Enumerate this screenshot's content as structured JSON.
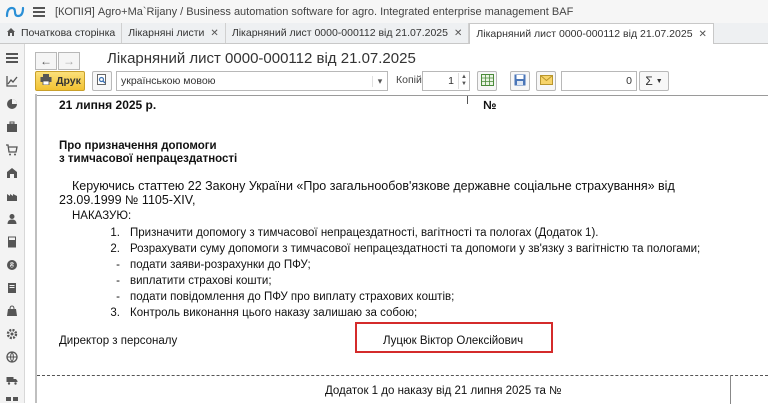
{
  "app": {
    "title": "[КОПІЯ] Agro+Ma`Rijany / Business automation software for agro. Integrated enterprise management BAF"
  },
  "tabs": [
    {
      "label": "Початкова сторінка",
      "closable": false
    },
    {
      "label": "Лікарняні листи",
      "closable": true
    },
    {
      "label": "Лікарняний лист 0000-000112 від 21.07.2025",
      "closable": true
    },
    {
      "label": "Лікарняний лист 0000-000112 від 21.07.2025",
      "closable": true,
      "active": true
    }
  ],
  "header": {
    "title": "Лікарняний лист 0000-000112 від 21.07.2025"
  },
  "toolbar": {
    "print_label": "Друк",
    "language_value": "українською мовою",
    "copies_label": "Копій:",
    "copies_value": "1",
    "amount_value": "0",
    "sigma_label": "Σ"
  },
  "document": {
    "date_line": "21 липня 2025 р.",
    "number_sign": "№",
    "heading_line1": "Про призначення допомоги",
    "heading_line2": "з тимчасової непрацездатності",
    "para_line1": "Керуючись статтею 22 Закону України «Про загальнообов'язкове державне соціальне страхування» від",
    "para_line2": "23.09.1999 № 1105-XIV,",
    "order_word": "НАКАЗУЮ:",
    "items": [
      {
        "marker": "1.",
        "text": "Призначити допомогу з тимчасової непрацездатності, вагітності та пологах (Додаток 1)."
      },
      {
        "marker": "2.",
        "text": "Розрахувати суму допомоги з тимчасової непрацездатності та допомоги у зв'язку з вагітністю та пологами;"
      },
      {
        "marker": "-",
        "text": "подати заяви-розрахунки до ПФУ;"
      },
      {
        "marker": "-",
        "text": "виплатити страхові кошти;"
      },
      {
        "marker": "-",
        "text": "подати повідомлення до ПФУ про виплату страхових коштів;"
      },
      {
        "marker": "3.",
        "text": "Контроль виконання цього наказу залишаю за собою;"
      }
    ],
    "director_label": "Директор з персоналу",
    "signer_name": "Луцюк Віктор Олексійович",
    "footer_text": "Додаток 1 до наказу від  21 липня 2025 та №"
  },
  "colors": {
    "highlight_box": "#d42b2b",
    "print_button": "#f2c232",
    "sidebar_bg": "#f3f3f3"
  }
}
